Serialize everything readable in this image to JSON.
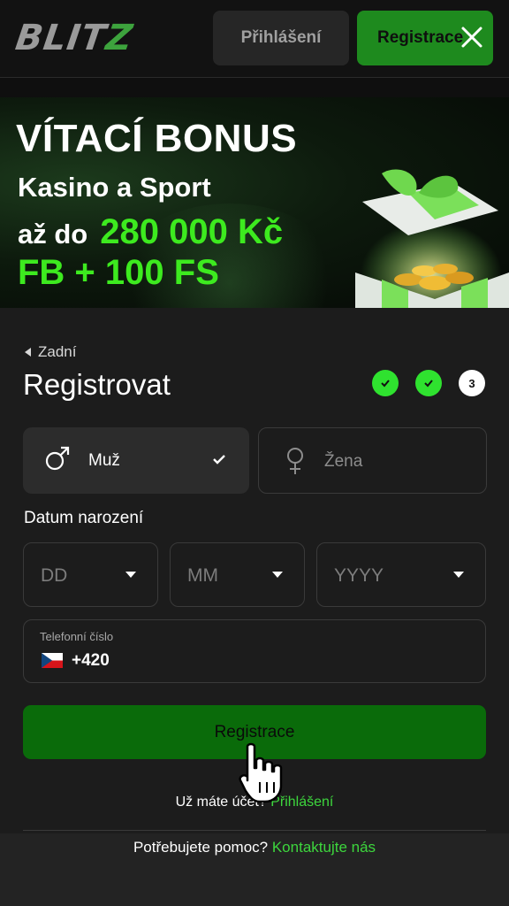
{
  "header": {
    "logo_main": "BLIT",
    "logo_accent": "Z",
    "login_label": "Přihlášení",
    "register_label": "Registrace",
    "close_icon": "close-icon"
  },
  "banner": {
    "line1": "VÍTACÍ BONUS",
    "line2": "Kasino a Sport",
    "line3_prefix": "až do",
    "line3_amount": "280 000 Kč",
    "line4": "FB + 100 FS",
    "accent_color": "#3dea1f"
  },
  "form": {
    "back_label": "Zadní",
    "title": "Registrovat",
    "steps": [
      {
        "state": "done",
        "label": ""
      },
      {
        "state": "done",
        "label": ""
      },
      {
        "state": "current",
        "label": "3"
      }
    ],
    "gender": {
      "male_label": "Muž",
      "female_label": "Žena",
      "selected": "male"
    },
    "dob_label": "Datum narození",
    "dob": {
      "day_placeholder": "DD",
      "month_placeholder": "MM",
      "year_placeholder": "YYYY"
    },
    "phone": {
      "label": "Telefonní číslo",
      "country_code": "+420",
      "flag": "czech-flag-icon"
    },
    "submit_label": "Registrace",
    "have_account_text": "Už máte účet?",
    "login_link": "Přihlášení"
  },
  "footer": {
    "help_text": "Potřebujete pomoc?",
    "contact_link": "Kontaktujte nás"
  },
  "colors": {
    "brand_green": "#1e8a1e",
    "link_green": "#3dd63d",
    "step_done": "#2fe22f"
  }
}
